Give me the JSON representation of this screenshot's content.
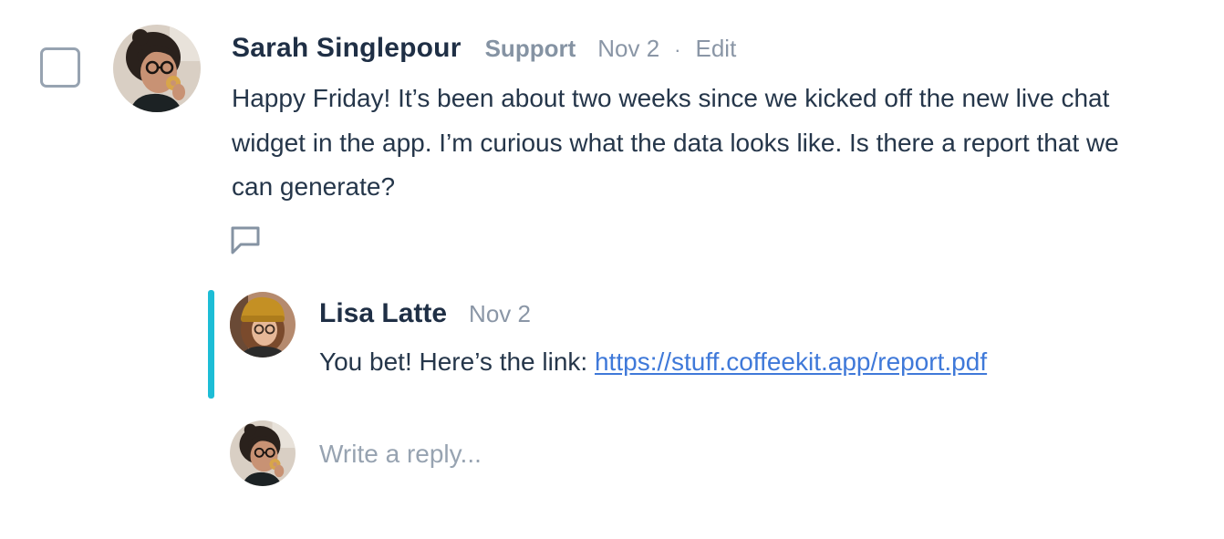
{
  "post": {
    "author": "Sarah Singlepour",
    "role": "Support",
    "date": "Nov 2",
    "separator": "·",
    "edit_label": "Edit",
    "message": "Happy Friday! It’s been about two weeks since we kicked off the new live chat widget in the app. I’m curious what the data looks like. Is there a report that we can generate?"
  },
  "reply": {
    "author": "Lisa Latte",
    "date": "Nov 2",
    "text": "You bet! Here’s the link: ",
    "link": "https://stuff.coffeekit.app/report.pdf"
  },
  "composer": {
    "placeholder": "Write a reply..."
  },
  "colors": {
    "thread_accent": "#1dbdd6",
    "link": "#3f79d9",
    "text": "#25364a",
    "muted": "#8a96a6"
  },
  "icons": {
    "checkbox": "checkbox-icon",
    "comment": "comment-icon"
  }
}
